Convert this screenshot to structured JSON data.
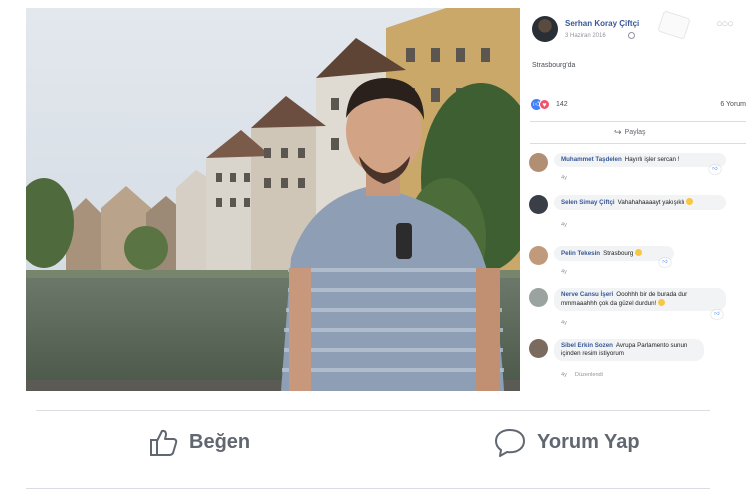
{
  "post": {
    "author": "Serhan Koray Çiftçi",
    "date": "3 Haziran 2016",
    "caption": "Strasbourg'da",
    "reaction_count": "142",
    "comment_count": "6 Yorum",
    "share_label": "Paylaş"
  },
  "comments": [
    {
      "author": "Muhammet Taşdelen",
      "text": "Hayırlı işler sercan !",
      "time": "4y",
      "reply": "",
      "avatar_color": "#b08f72"
    },
    {
      "author": "Selen Simay Çiftçi",
      "text": "Vahahahaaaayt yakışıklı",
      "time": "4y",
      "reply": "",
      "avatar_color": "#3a3f47"
    },
    {
      "author": "Pelin Tekesin",
      "text": "Strasbourg",
      "time": "4y",
      "reply": "",
      "avatar_color": "#c09a7a"
    },
    {
      "author": "Nerve Cansu İşeri",
      "text": "Ooohhh bir de burada dur mmmaaahhh çok da güzel durdun!",
      "time": "4y",
      "reply": "",
      "avatar_color": "#9aa3a0"
    },
    {
      "author": "Sibel Erkin Sozen",
      "text": "Avrupa Parlamento sunun içinden resim istiyorum",
      "time": "4y",
      "reply": "Düzenlendi",
      "avatar_color": "#7b6a5e"
    }
  ],
  "actions": {
    "like_label": "Beğen",
    "comment_label": "Yorum Yap"
  },
  "icons": {
    "like": "thumbs-up-icon",
    "comment": "speech-bubble-icon",
    "share": "share-arrow-icon"
  },
  "colors": {
    "link_blue": "#385898",
    "like_blue": "#4080ff",
    "love_red": "#f25268",
    "action_gray": "#606770"
  }
}
